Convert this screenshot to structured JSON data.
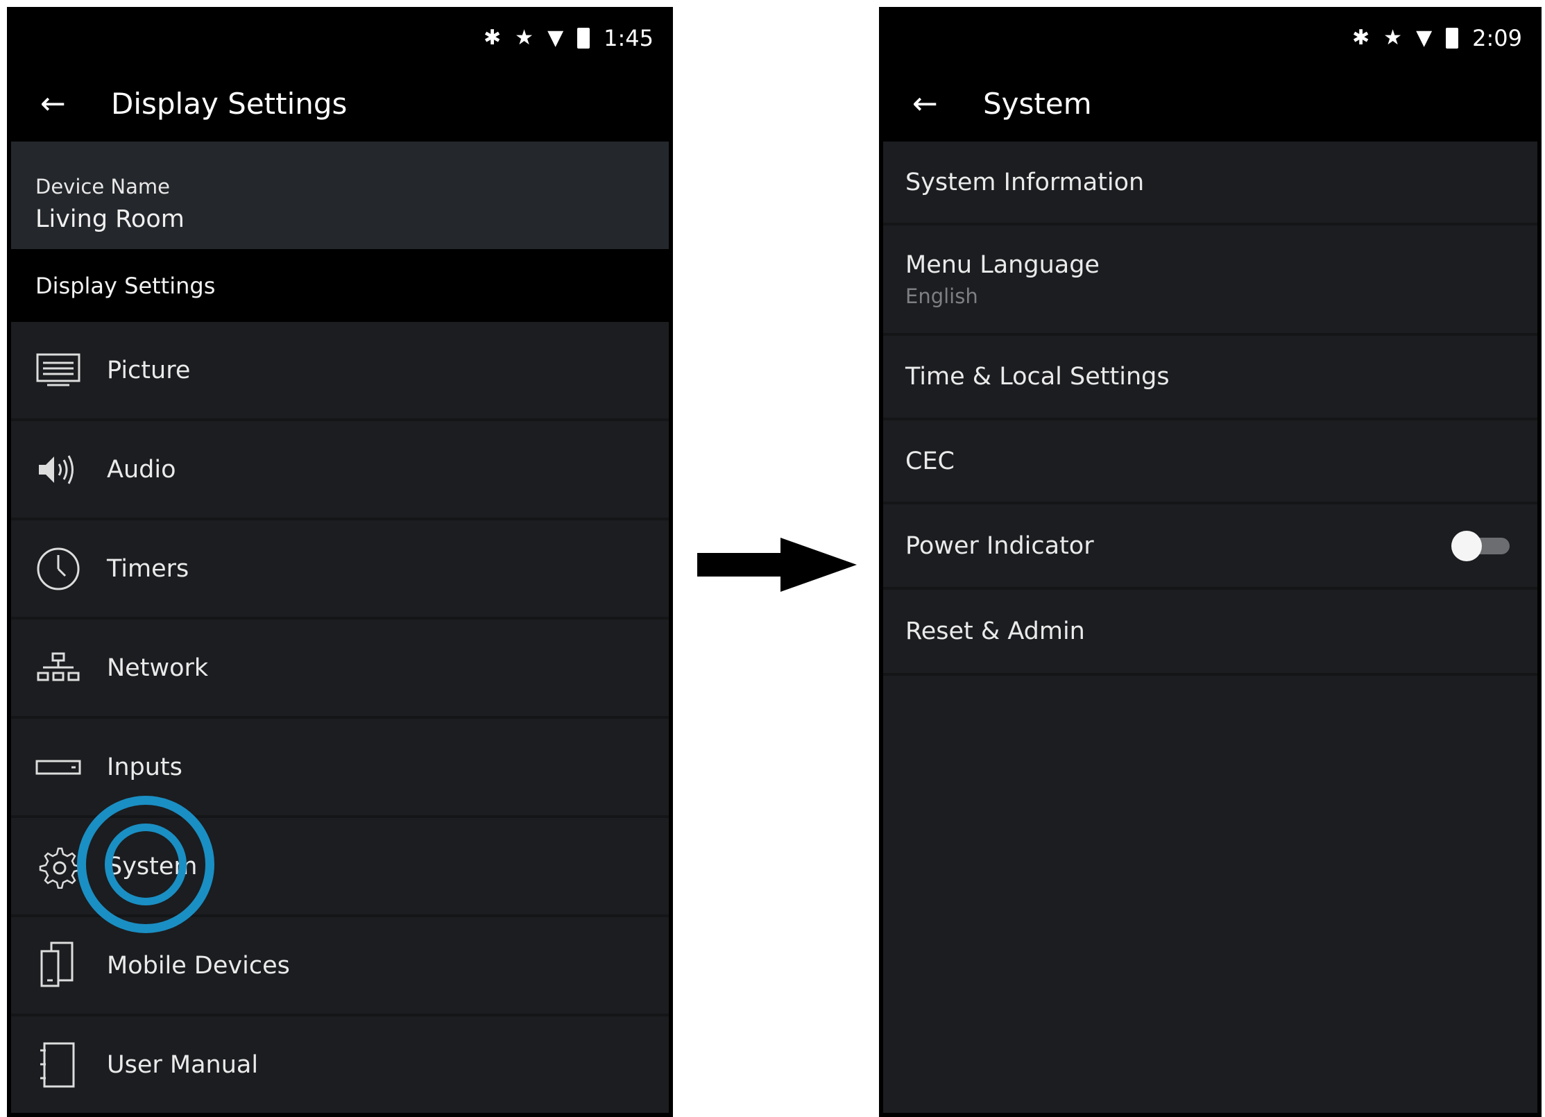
{
  "left": {
    "status": {
      "time": "1:45",
      "icons": [
        "bluetooth-icon",
        "star-icon",
        "wifi-icon",
        "battery-icon"
      ]
    },
    "header": {
      "back_icon": "back-arrow-icon",
      "title": "Display Settings"
    },
    "device": {
      "label": "Device Name",
      "value": "Living Room"
    },
    "section_title": "Display Settings",
    "menu": [
      {
        "label": "Picture",
        "icon": "picture-icon"
      },
      {
        "label": "Audio",
        "icon": "speaker-icon"
      },
      {
        "label": "Timers",
        "icon": "clock-icon"
      },
      {
        "label": "Network",
        "icon": "network-icon"
      },
      {
        "label": "Inputs",
        "icon": "input-icon"
      },
      {
        "label": "System",
        "icon": "gear-icon",
        "highlighted": true
      },
      {
        "label": "Mobile Devices",
        "icon": "mobile-devices-icon"
      },
      {
        "label": "User Manual",
        "icon": "manual-icon"
      }
    ],
    "highlight_color": "#1a8fc4"
  },
  "right": {
    "status": {
      "time": "2:09",
      "icons": [
        "bluetooth-icon",
        "star-icon",
        "wifi-icon",
        "battery-icon"
      ]
    },
    "header": {
      "back_icon": "back-arrow-icon",
      "title": "System"
    },
    "menu": [
      {
        "label": "System Information"
      },
      {
        "label": "Menu Language",
        "sub": "English"
      },
      {
        "label": "Time & Local Settings"
      },
      {
        "label": "CEC"
      },
      {
        "label": "Power Indicator",
        "toggle": "off"
      },
      {
        "label": "Reset & Admin"
      }
    ]
  },
  "transition_arrow": "right-arrow-icon"
}
